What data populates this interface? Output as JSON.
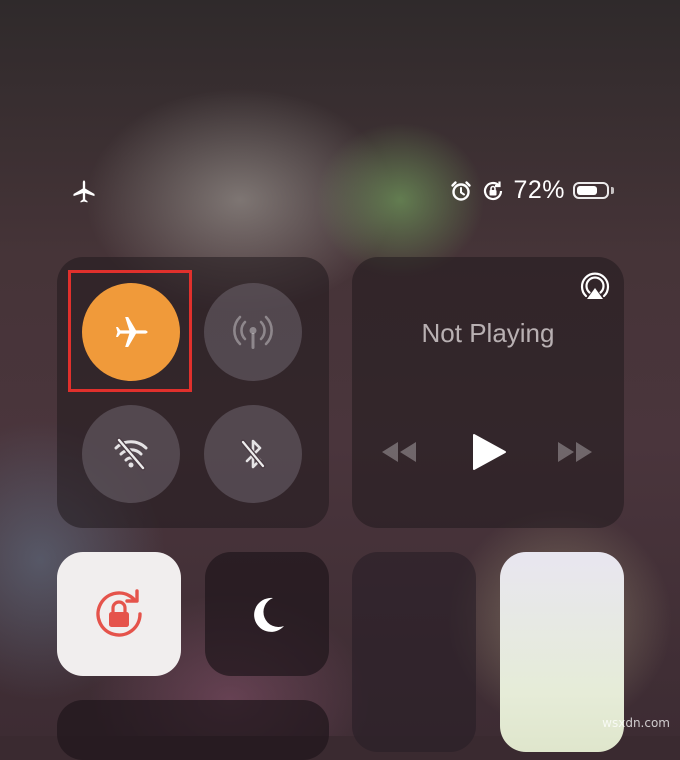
{
  "status_bar": {
    "battery_percent_text": "72%",
    "battery_level": 0.72,
    "icons": [
      "airplane-icon",
      "alarm-icon",
      "orientation-lock-icon",
      "battery-icon"
    ]
  },
  "connectivity": {
    "airplane_mode": {
      "icon": "airplane-icon",
      "state": "on",
      "color": "#f09a3a"
    },
    "cellular": {
      "icon": "cellular-antenna-icon",
      "state": "off"
    },
    "wifi": {
      "icon": "wifi-off-icon",
      "state": "off"
    },
    "bluetooth": {
      "icon": "bluetooth-off-icon",
      "state": "off"
    },
    "highlight_color": "#e0302c"
  },
  "media": {
    "title": "Not Playing",
    "icons": [
      "airplay-icon",
      "rewind-icon",
      "play-icon",
      "fast-forward-icon"
    ]
  },
  "tiles": {
    "orientation_lock": {
      "icon": "orientation-lock-icon",
      "state": "on",
      "color": "#e5534b"
    },
    "do_not_disturb": {
      "icon": "moon-icon",
      "state": "off"
    }
  },
  "watermark": "wsxdn.com"
}
